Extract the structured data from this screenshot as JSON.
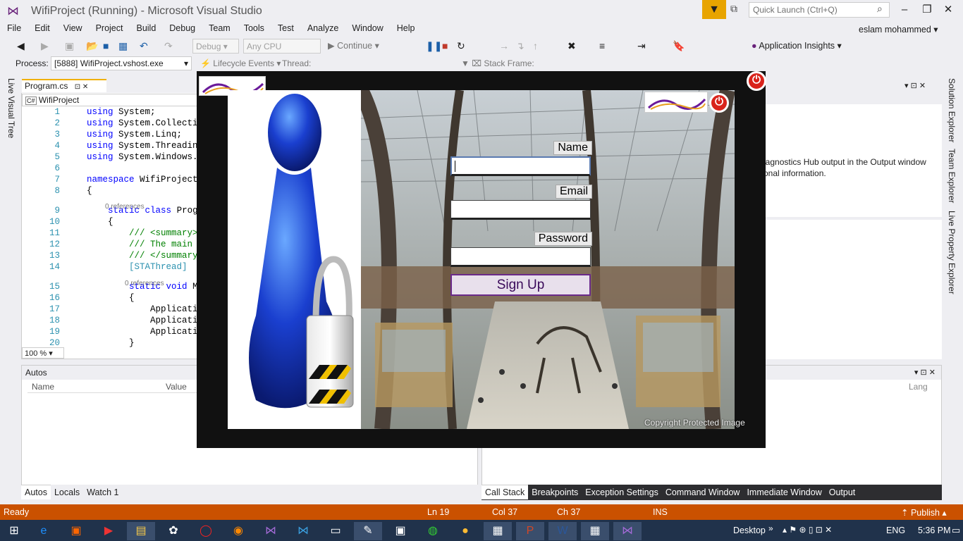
{
  "window": {
    "title": "WifiProject (Running) - Microsoft Visual Studio",
    "quick_launch_placeholder": "Quick Launch (Ctrl+Q)",
    "user": "eslam mohammed"
  },
  "menu": [
    "File",
    "Edit",
    "View",
    "Project",
    "Build",
    "Debug",
    "Team",
    "Tools",
    "Test",
    "Analyze",
    "Window",
    "Help"
  ],
  "toolbar": {
    "config": "Debug",
    "platform": "Any CPU",
    "continue_label": "Continue",
    "app_insights_label": "Application Insights"
  },
  "debug_toolbar": {
    "process_label": "Process:",
    "process_value": "[5888] WifiProject.vshost.exe",
    "lifecycle_label": "Lifecycle Events",
    "thread_label": "Thread:",
    "stack_frame_label": "Stack Frame:"
  },
  "side_tabs": {
    "left": [
      "Live Visual Tree"
    ],
    "right": [
      "Solution Explorer",
      "Team Explorer",
      "Live Property Explorer"
    ]
  },
  "editor": {
    "tab_label": "Program.cs",
    "nav_project": "WifiProject",
    "zoom": "100 %",
    "code_lines": [
      {
        "n": "1",
        "text": "using System;"
      },
      {
        "n": "2",
        "text": "using System.Collection"
      },
      {
        "n": "3",
        "text": "using System.Linq;"
      },
      {
        "n": "4",
        "text": "using System.Threading"
      },
      {
        "n": "5",
        "text": "using System.Windows.Fo"
      },
      {
        "n": "6",
        "text": ""
      },
      {
        "n": "7",
        "text": "namespace WifiProject"
      },
      {
        "n": "8",
        "text": "{"
      },
      {
        "n": "9",
        "text": "    static class Progra"
      },
      {
        "n": "10",
        "text": "    {"
      },
      {
        "n": "11",
        "text": "        /// <summary>"
      },
      {
        "n": "12",
        "text": "        /// The main e"
      },
      {
        "n": "13",
        "text": "        /// </summary>"
      },
      {
        "n": "14",
        "text": "        [STAThread]"
      },
      {
        "n": "15",
        "text": "        static void Ma"
      },
      {
        "n": "16",
        "text": "        {"
      },
      {
        "n": "17",
        "text": "            Application"
      },
      {
        "n": "18",
        "text": "            Application"
      },
      {
        "n": "19",
        "text": "            Application"
      },
      {
        "n": "20",
        "text": "        }"
      }
    ],
    "references_label": "0 references"
  },
  "right_panel": {
    "text_line1": "iagnostics Hub output in the Output window",
    "text_line2": "onal information."
  },
  "autos_panel": {
    "title": "Autos",
    "col_name": "Name",
    "col_value": "Value",
    "tabs": [
      "Autos",
      "Locals",
      "Watch 1"
    ]
  },
  "callstack_panel": {
    "col_lang": "Lang",
    "tabs": [
      "Call Stack",
      "Breakpoints",
      "Exception Settings",
      "Command Window",
      "Immediate Window",
      "Output"
    ]
  },
  "statusbar": {
    "ready": "Ready",
    "ln": "Ln 19",
    "col": "Col 37",
    "ch": "Ch 37",
    "ins": "INS",
    "publish": "Publish"
  },
  "taskbar": {
    "desktop_label": "Desktop",
    "lang": "ENG",
    "time": "5:36 PM"
  },
  "app_form": {
    "name_label": "Name",
    "email_label": "Email",
    "password_label": "Password",
    "signup_label": "Sign Up",
    "copyright": "Copyright Protected Image"
  },
  "colors": {
    "accent_status": "#ca5100",
    "taskbar": "#20324b",
    "vs_purple": "#68217a"
  }
}
